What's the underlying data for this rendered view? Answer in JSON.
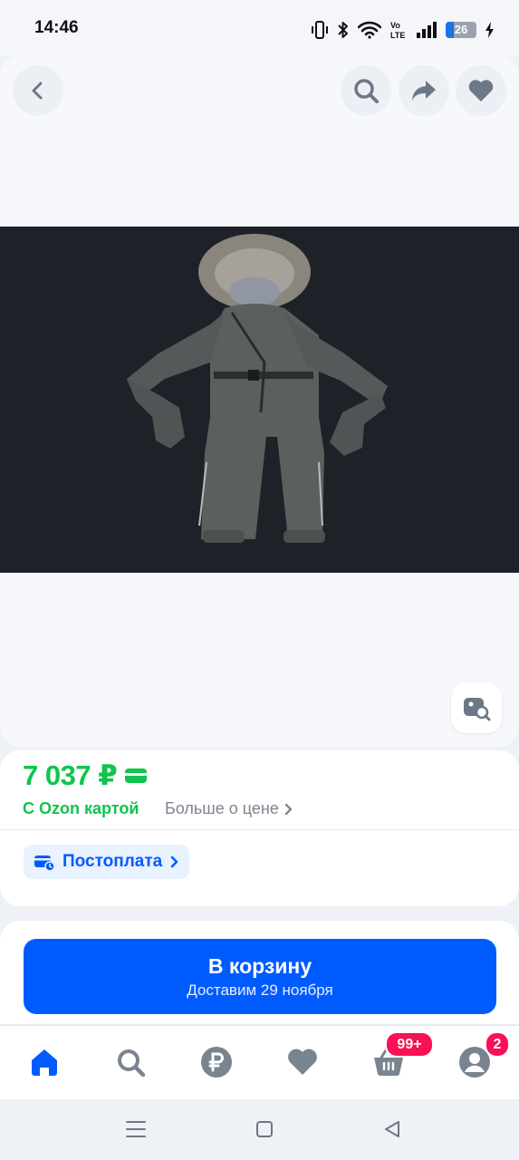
{
  "status_bar": {
    "time": "14:46",
    "battery": "26"
  },
  "product": {
    "price": "7 037 ₽",
    "price_note": "С Ozon картой",
    "more_price": "Больше о цене",
    "postpay": "Постоплата"
  },
  "cart": {
    "button_label": "В корзину",
    "delivery": "Доставим 29 ноября"
  },
  "nav": {
    "items": [
      "home-icon",
      "search-icon",
      "ruble-icon",
      "heart-icon",
      "basket-icon",
      "profile-icon"
    ],
    "cart_badge": "99+",
    "profile_badge": "2"
  },
  "colors": {
    "accent_blue": "#005bff",
    "price_green": "#10c44c",
    "badge_pink": "#f91155"
  }
}
